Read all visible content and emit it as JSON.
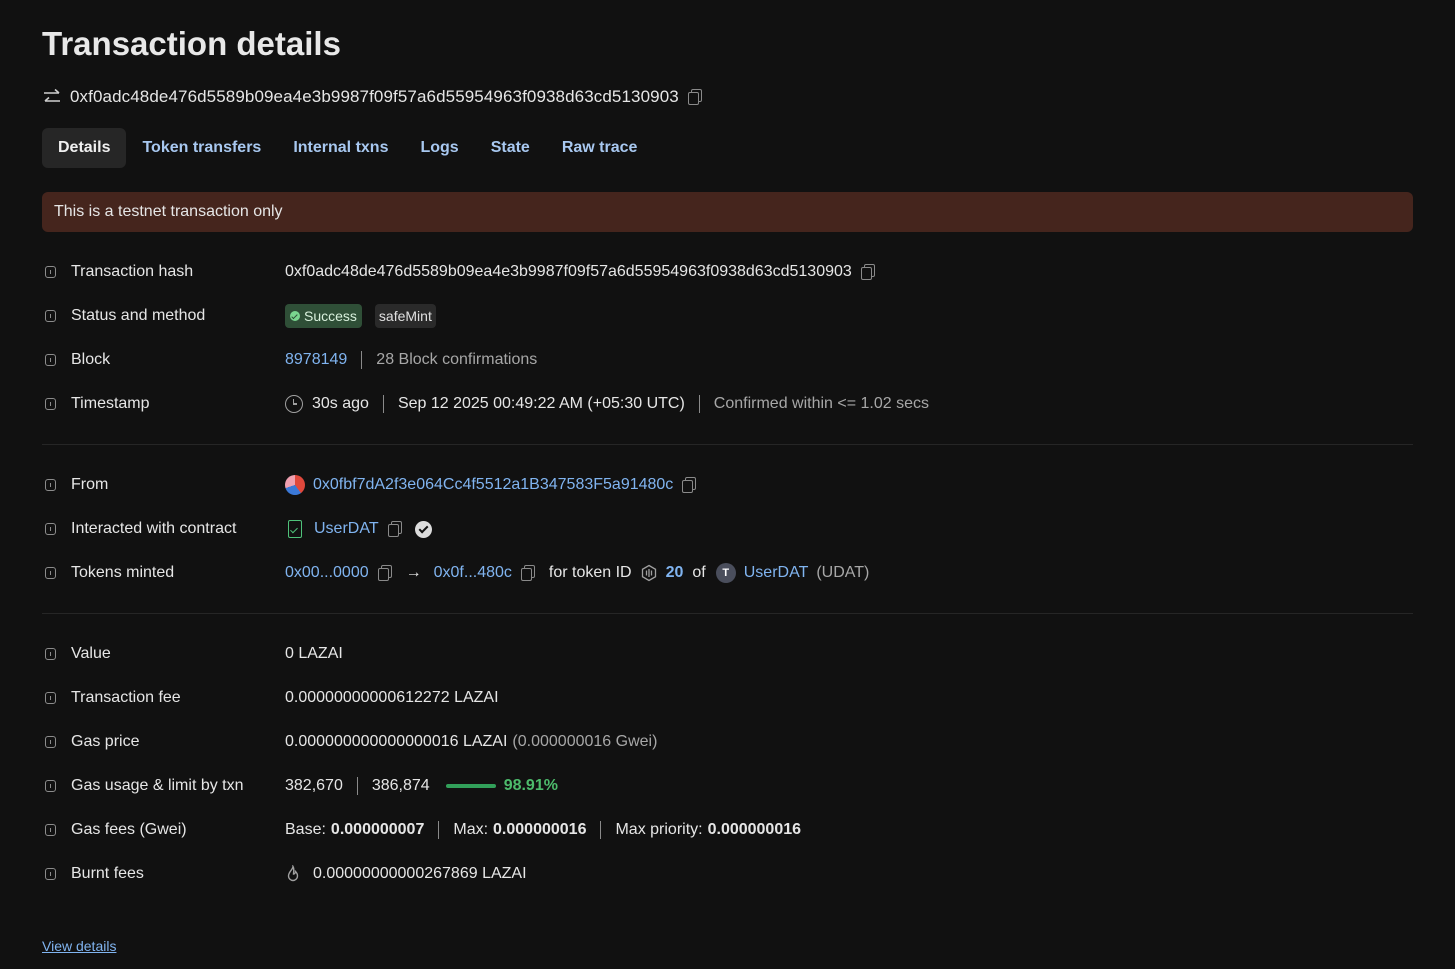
{
  "page": {
    "title": "Transaction details",
    "tx_hash": "0xf0adc48de476d5589b09ea4e3b9987f09f57a6d55954963f0938d63cd5130903"
  },
  "tabs": [
    {
      "label": "Details",
      "active": true
    },
    {
      "label": "Token transfers"
    },
    {
      "label": "Internal txns"
    },
    {
      "label": "Logs"
    },
    {
      "label": "State"
    },
    {
      "label": "Raw trace"
    }
  ],
  "banner": "This is a testnet transaction only",
  "details": {
    "tx_hash_label": "Transaction hash",
    "tx_hash_value": "0xf0adc48de476d5589b09ea4e3b9987f09f57a6d55954963f0938d63cd5130903",
    "status_label": "Status and method",
    "status_value": "Success",
    "method_value": "safeMint",
    "block_label": "Block",
    "block_value": "8978149",
    "block_confirmations": "28 Block confirmations",
    "timestamp_label": "Timestamp",
    "timestamp_ago": "30s ago",
    "timestamp_date": "Sep 12 2025 00:49:22 AM (+05:30 UTC)",
    "timestamp_confirmed": "Confirmed within <= 1.02 secs",
    "from_label": "From",
    "from_value": "0x0fbf7dA2f3e064Cc4f5512a1B347583F5a91480c",
    "contract_label": "Interacted with contract",
    "contract_value": "UserDAT",
    "minted_label": "Tokens minted",
    "minted_from": "0x00...0000",
    "minted_to": "0x0f...480c",
    "minted_for_text": "for token ID",
    "minted_token_id": "20",
    "minted_of_text": "of",
    "minted_token_icon_letter": "T",
    "minted_token_name": "UserDAT",
    "minted_token_symbol": "(UDAT)",
    "value_label": "Value",
    "value_value": "0 LAZAI",
    "fee_label": "Transaction fee",
    "fee_value": "0.00000000000612272 LAZAI",
    "gas_price_label": "Gas price",
    "gas_price_value": "0.000000000000000016 LAZAI",
    "gas_price_gwei": "(0.000000016 Gwei)",
    "gas_usage_label": "Gas usage & limit by txn",
    "gas_used": "382,670",
    "gas_limit": "386,874",
    "gas_usage_pct": "98.91%",
    "gas_usage_fraction": 0.9891,
    "gas_fees_label": "Gas fees (Gwei)",
    "gas_base_label": "Base:",
    "gas_base_value": "0.000000007",
    "gas_max_label": "Max:",
    "gas_max_value": "0.000000016",
    "gas_priority_label": "Max priority:",
    "gas_priority_value": "0.000000016",
    "burnt_label": "Burnt fees",
    "burnt_value": "0.00000000000267869 LAZAI"
  },
  "footer": {
    "view_details": "View details"
  },
  "icons": {
    "swap": "swap-arrows-icon",
    "copy": "copy-icon",
    "info": "info-icon",
    "clock": "clock-icon",
    "contract": "contract-file-icon",
    "verified": "verified-check-icon",
    "token_id": "hexagon-nft-icon",
    "flame": "flame-icon"
  },
  "colors": {
    "background": "#111111",
    "link": "#80b4f0",
    "banner": "#45251d",
    "success_badge": "#2f4f37",
    "progress": "#32a05a"
  }
}
